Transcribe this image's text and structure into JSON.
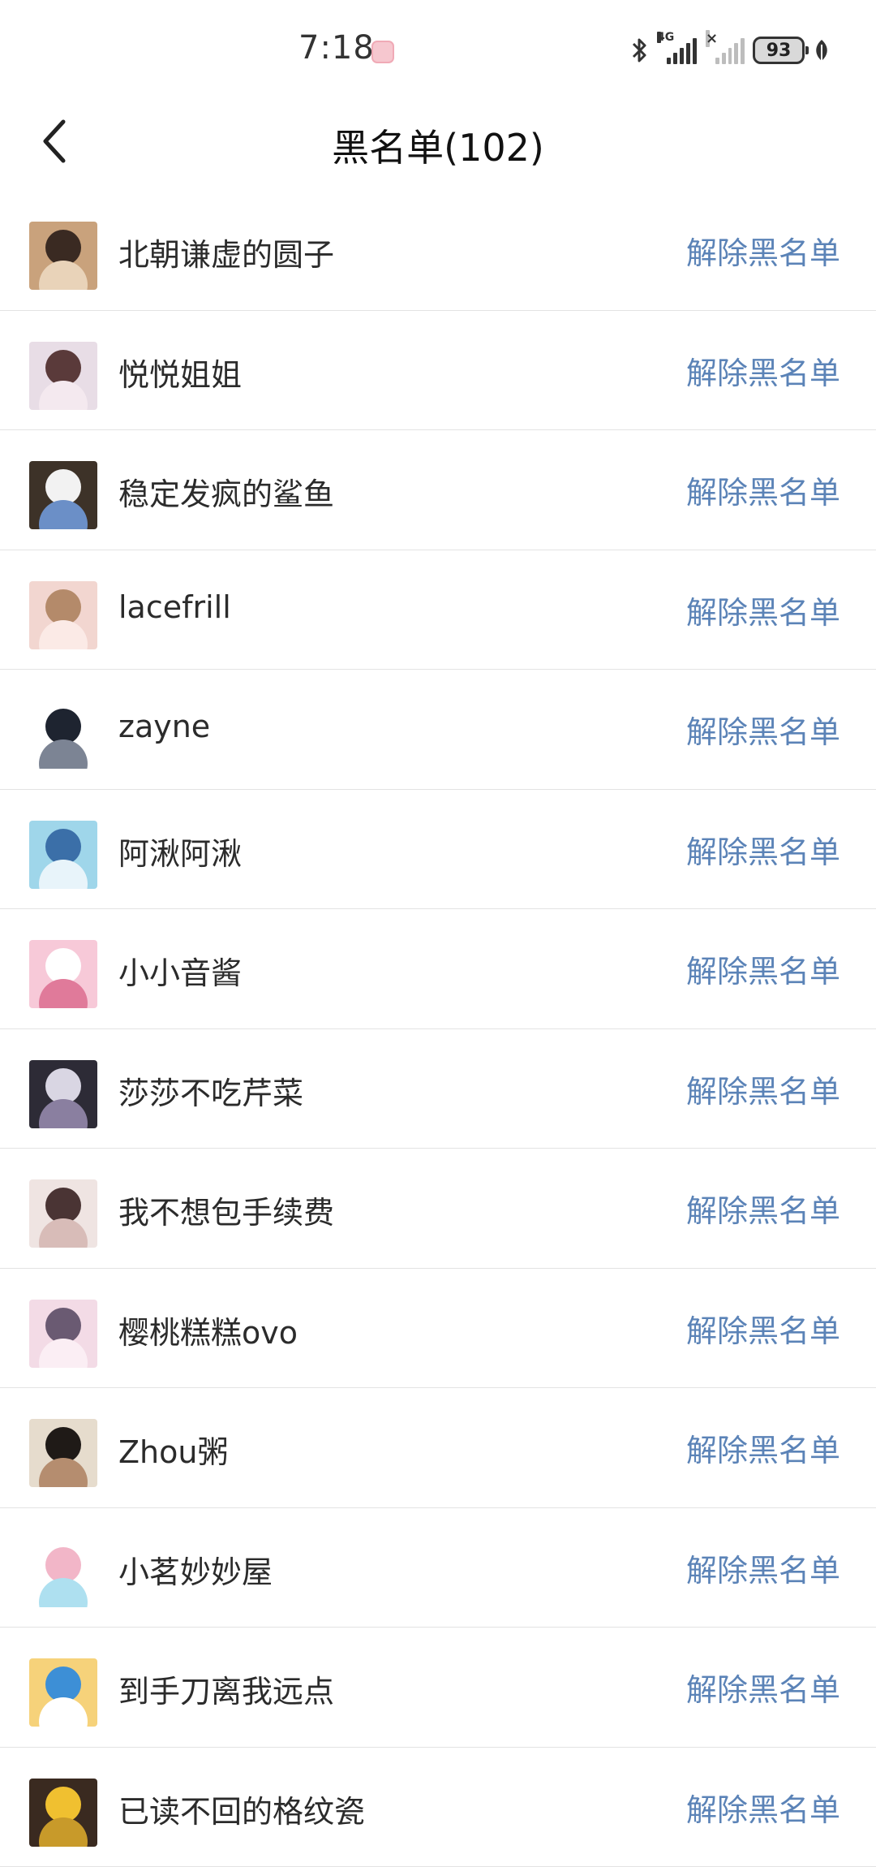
{
  "status_bar": {
    "time": "7:18",
    "network": "4G",
    "battery": "93"
  },
  "header": {
    "title": "黑名单(102)"
  },
  "blacklist": {
    "unblock_label": "解除黑名单",
    "items": [
      {
        "name": "北朝谦虚的圆子",
        "avatar_colors": [
          "#c9a27c",
          "#3a2a22",
          "#e9d3b9"
        ]
      },
      {
        "name": "悦悦姐姐",
        "avatar_colors": [
          "#e8dde6",
          "#5a3a3a",
          "#f4e9ef"
        ]
      },
      {
        "name": "稳定发疯的鲨鱼",
        "avatar_colors": [
          "#3d3228",
          "#f2f2f2",
          "#6b8fc7"
        ]
      },
      {
        "name": "lacefrill",
        "avatar_colors": [
          "#f2d6d0",
          "#b48a6a",
          "#fbeae6"
        ]
      },
      {
        "name": "zayne",
        "avatar_colors": [
          "#ffffff",
          "#1e2430",
          "#7c8494"
        ]
      },
      {
        "name": "阿湫阿湫",
        "avatar_colors": [
          "#9fd6ea",
          "#3b6fa8",
          "#e8f4fa"
        ]
      },
      {
        "name": "小小音酱",
        "avatar_colors": [
          "#f7c9d8",
          "#ffffff",
          "#e07a9a"
        ]
      },
      {
        "name": "莎莎不吃芹菜",
        "avatar_colors": [
          "#2d2b36",
          "#d9d6e3",
          "#8a7fa0"
        ]
      },
      {
        "name": "我不想包手续费",
        "avatar_colors": [
          "#efe4e2",
          "#4a3434",
          "#d8bcb8"
        ]
      },
      {
        "name": "樱桃糕糕ovo",
        "avatar_colors": [
          "#f3dbe6",
          "#6a5a72",
          "#fbeef4"
        ]
      },
      {
        "name": "Zhou粥",
        "avatar_colors": [
          "#e6dccd",
          "#1f1a17",
          "#b58d6f"
        ]
      },
      {
        "name": "小茗妙妙屋",
        "avatar_colors": [
          "#ffffff",
          "#f2b6c8",
          "#aee0f0"
        ]
      },
      {
        "name": "到手刀离我远点",
        "avatar_colors": [
          "#f6d27a",
          "#3d8fd6",
          "#ffffff"
        ]
      },
      {
        "name": "已读不回的格纹瓷",
        "avatar_colors": [
          "#3a2a20",
          "#f0c030",
          "#c89a2a"
        ]
      }
    ]
  },
  "colors": {
    "accent": "#5b83b7",
    "divider": "#e3e3e3"
  }
}
